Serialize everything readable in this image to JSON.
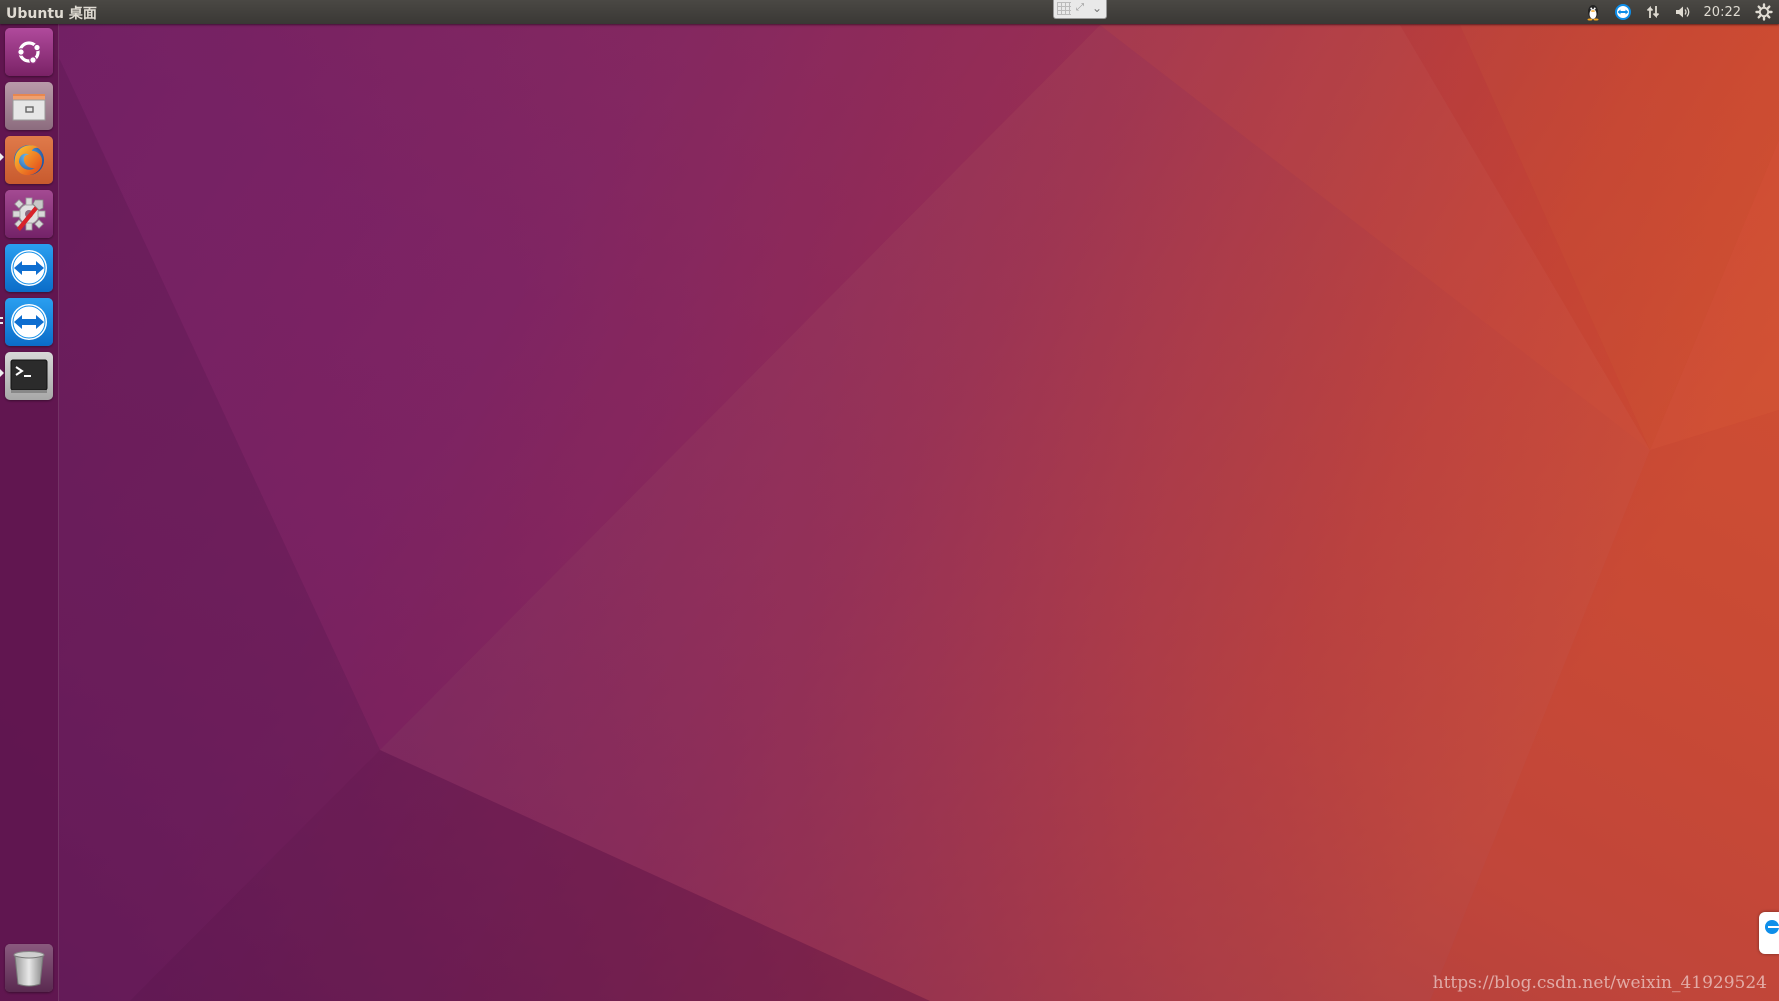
{
  "top_panel": {
    "title": "Ubuntu 桌面",
    "clock": "20:22",
    "indicators": [
      {
        "name": "qq-penguin-icon"
      },
      {
        "name": "teamviewer-tray-icon"
      },
      {
        "name": "network-icon"
      },
      {
        "name": "volume-icon"
      },
      {
        "name": "settings-gear-icon"
      }
    ],
    "ime_widget": {
      "icons": [
        "keyboard-grid-icon",
        "expand-icon",
        "chevron-down-icon"
      ]
    }
  },
  "launcher": {
    "items": [
      {
        "name": "dash-home",
        "icon": "ubuntu-logo-icon",
        "running": false
      },
      {
        "name": "files",
        "icon": "file-cabinet-icon",
        "running": false
      },
      {
        "name": "firefox",
        "icon": "firefox-icon",
        "running": true
      },
      {
        "name": "system-settings",
        "icon": "settings-tools-icon",
        "running": false
      },
      {
        "name": "teamviewer",
        "icon": "teamviewer-icon",
        "running": false
      },
      {
        "name": "teamviewer-2",
        "icon": "teamviewer-icon",
        "running": true
      },
      {
        "name": "terminal",
        "icon": "terminal-icon",
        "running": true
      }
    ],
    "trash": {
      "icon": "trash-icon"
    }
  },
  "watermark": "https://blog.csdn.net/weixin_41929524",
  "colors": {
    "wallpaper_left": "#6b1f5e",
    "wallpaper_right": "#d04a2a",
    "panel": "#3c3b37",
    "launcher": "#60164e",
    "teamviewer_blue": "#0e8ee9"
  }
}
